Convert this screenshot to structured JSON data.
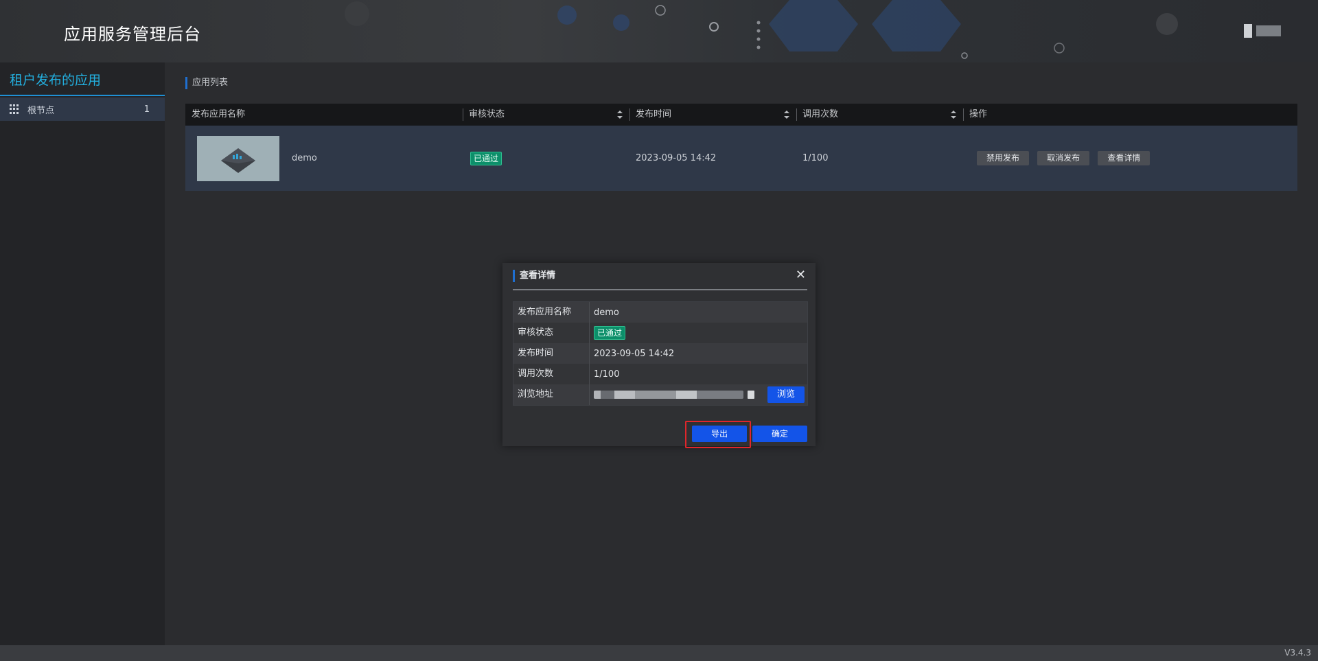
{
  "header": {
    "title": "应用服务管理后台"
  },
  "sidebar": {
    "title": "租户发布的应用",
    "items": [
      {
        "label": "根节点",
        "count": "1"
      }
    ]
  },
  "main": {
    "section_title": "应用列表",
    "columns": [
      "发布应用名称",
      "审核状态",
      "发布时间",
      "调用次数",
      "操作"
    ],
    "rows": [
      {
        "name": "demo",
        "status": "已通过",
        "time": "2023-09-05 14:42",
        "calls": "1/100",
        "actions": [
          "禁用发布",
          "取消发布",
          "查看详情"
        ]
      }
    ]
  },
  "modal": {
    "title": "查看详情",
    "close": "✕",
    "fields": [
      {
        "label": "发布应用名称",
        "value": "demo"
      },
      {
        "label": "审核状态",
        "value": "已通过"
      },
      {
        "label": "发布时间",
        "value": "2023-09-05 14:42"
      },
      {
        "label": "调用次数",
        "value": "1/100"
      },
      {
        "label": "浏览地址"
      }
    ],
    "browse_label": "浏览",
    "export_label": "导出",
    "ok_label": "确定"
  },
  "footer": {
    "version": "V3.4.3"
  },
  "colors": {
    "accent": "#1354e8",
    "status_green": "#0c8f6a",
    "sidebar_title": "#23b0e0",
    "highlight": "#e0262b"
  }
}
